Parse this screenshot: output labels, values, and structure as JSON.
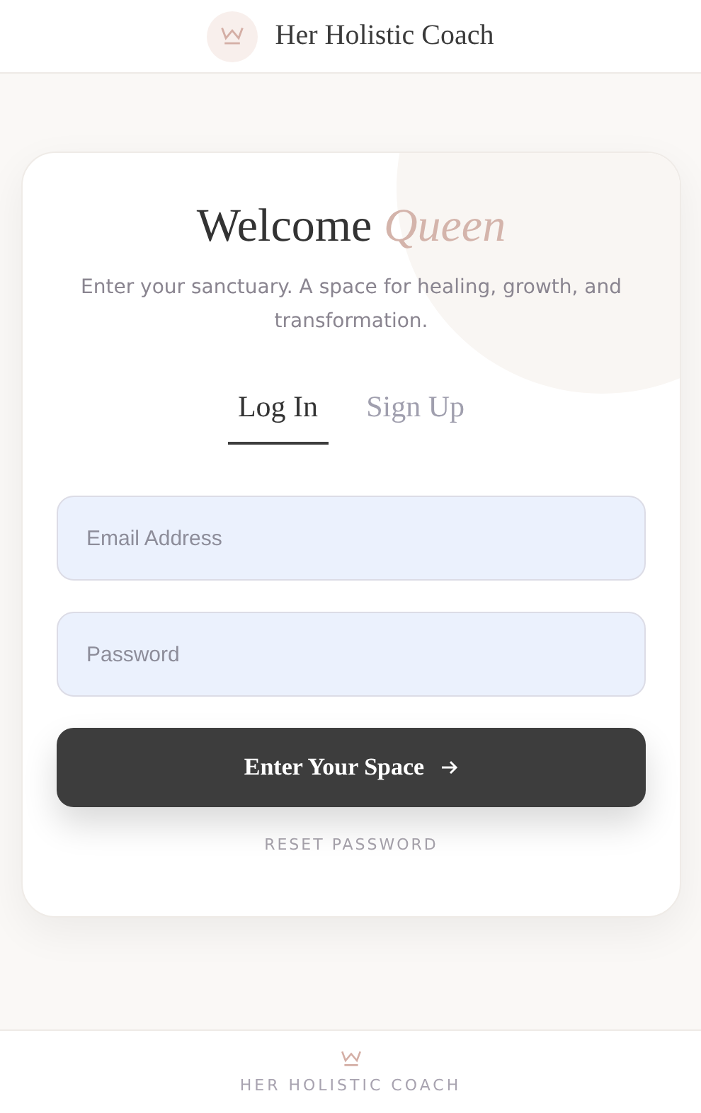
{
  "header": {
    "brand": "Her Holistic Coach"
  },
  "card": {
    "title": "Welcome *Queen*",
    "subtitle": "Enter your sanctuary. A space for healing, growth, and transformation.",
    "tabs": [
      {
        "label": "Log In",
        "selected": true
      },
      {
        "label": "Sign Up",
        "selected": false
      }
    ],
    "fields": [
      {
        "placeholder": "Email Address"
      },
      {
        "placeholder": "Password"
      }
    ],
    "submit": "Enter Your Space",
    "reset_link": "RESET PASSWORD"
  },
  "footer": {
    "brand": "HER HOLISTIC COACH"
  }
}
